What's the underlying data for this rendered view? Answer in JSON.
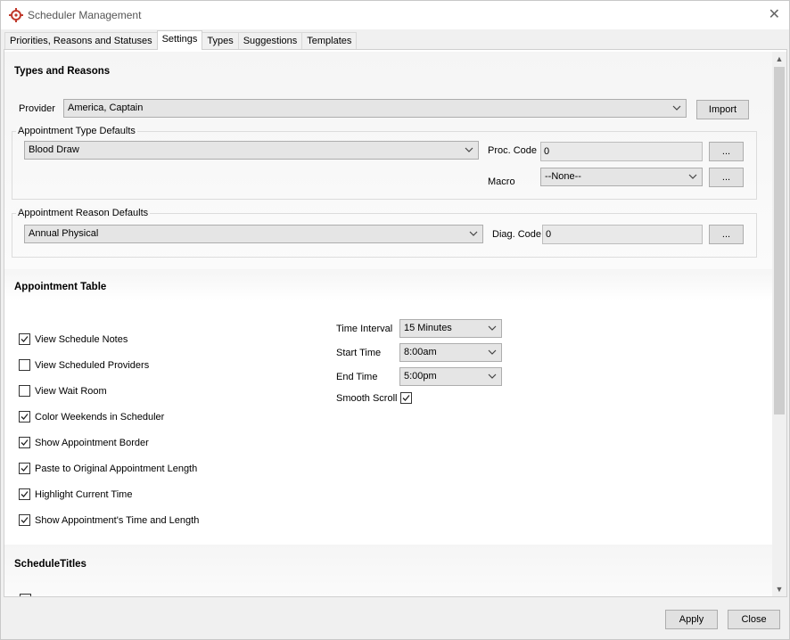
{
  "window": {
    "title": "Scheduler Management"
  },
  "tabs": [
    {
      "label": "Priorities, Reasons and Statuses",
      "active": false
    },
    {
      "label": "Settings",
      "active": true
    },
    {
      "label": "Types",
      "active": false
    },
    {
      "label": "Suggestions",
      "active": false
    },
    {
      "label": "Templates",
      "active": false
    }
  ],
  "types_reasons": {
    "header": "Types and Reasons",
    "provider_label": "Provider",
    "provider_value": "America, Captain",
    "import_label": "Import",
    "type_defaults": {
      "title": "Appointment Type Defaults",
      "type_value": "Blood Draw",
      "proc_code_label": "Proc. Code",
      "proc_code_value": "0",
      "macro_label": "Macro",
      "macro_value": "--None--",
      "browse_label": "..."
    },
    "reason_defaults": {
      "title": "Appointment Reason Defaults",
      "reason_value": "Annual Physical",
      "diag_code_label": "Diag. Code",
      "diag_code_value": "0",
      "browse_label": "..."
    }
  },
  "appointment_table": {
    "header": "Appointment Table",
    "checks": [
      {
        "label": "View Schedule Notes",
        "checked": true
      },
      {
        "label": "View Scheduled Providers",
        "checked": false
      },
      {
        "label": "View Wait Room",
        "checked": false
      },
      {
        "label": "Color Weekends in Scheduler",
        "checked": true
      },
      {
        "label": "Show Appointment Border",
        "checked": true
      },
      {
        "label": "Paste to Original Appointment Length",
        "checked": true
      },
      {
        "label": "Highlight Current Time",
        "checked": true
      },
      {
        "label": "Show Appointment's Time and Length",
        "checked": true
      }
    ],
    "time_interval_label": "Time Interval",
    "time_interval_value": "15 Minutes",
    "start_time_label": "Start Time",
    "start_time_value": "8:00am",
    "end_time_label": "End Time",
    "end_time_value": "5:00pm",
    "smooth_scroll_label": "Smooth Scroll",
    "smooth_scroll_checked": true
  },
  "schedule_titles": {
    "header": "ScheduleTitles"
  },
  "footer": {
    "apply_label": "Apply",
    "close_label": "Close"
  },
  "colors": {
    "accent": "#c0392b",
    "input_bg": "#e5e5e5",
    "section_bg": "#f5f5f5"
  }
}
